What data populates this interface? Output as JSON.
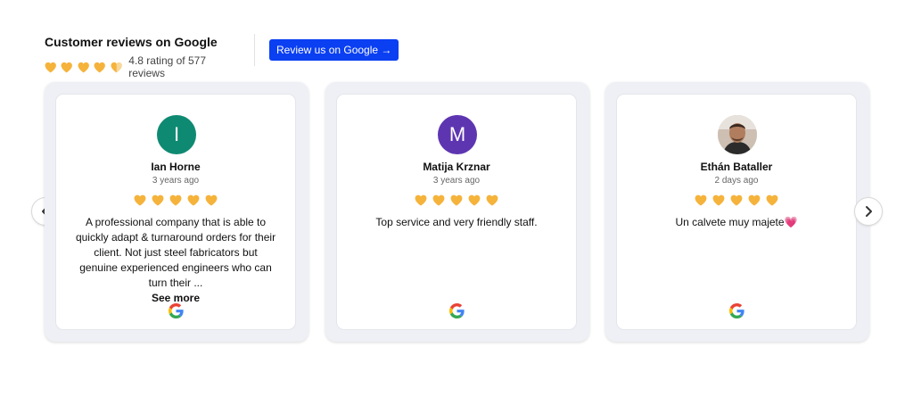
{
  "header": {
    "title": "Customer reviews on Google",
    "rating_text": "4.8 rating of 577 reviews",
    "review_button": "Review us on Google →"
  },
  "colors": {
    "heart": "#f5b33b",
    "button": "#0a3ff2",
    "card_bg": "#eef0f5"
  },
  "reviews": [
    {
      "name": "Ian Horne",
      "initial": "I",
      "avatar_color": "#0f8a72",
      "date": "3 years ago",
      "stars": 5,
      "text": "A professional company that is able to quickly adapt & turnaround orders for their client. Not just steel fabricators but genuine experienced engineers who can turn their ...",
      "see_more": "See more"
    },
    {
      "name": "Matija Krznar",
      "initial": "M",
      "avatar_color": "#5e35b1",
      "date": "3 years ago",
      "stars": 5,
      "text": "Top service and very friendly staff."
    },
    {
      "name": "Ethán Bataller",
      "avatar_icon": "photo-avatar",
      "date": "2 days ago",
      "stars": 5,
      "text": "Un calvete muy majete💗"
    }
  ],
  "icons": {
    "prev": "chevron-left-icon",
    "next": "chevron-right-icon",
    "google": "google-icon",
    "rating": "heart-icon"
  }
}
